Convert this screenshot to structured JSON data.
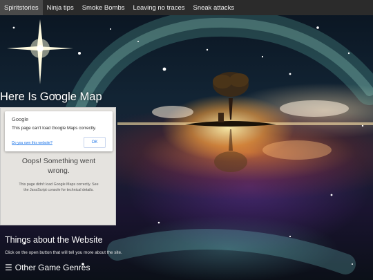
{
  "nav": {
    "items": [
      {
        "label": "Spiritstories",
        "active": true
      },
      {
        "label": "Ninja tips",
        "active": false
      },
      {
        "label": "Smoke Bombs",
        "active": false
      },
      {
        "label": "Leaving no traces",
        "active": false
      },
      {
        "label": "Sneak attacks",
        "active": false
      }
    ]
  },
  "main": {
    "title": "Here Is Google Map"
  },
  "map": {
    "brand": "Google",
    "error_message": "This page can't load Google Maps correctly.",
    "own_site_link": "Do you own this website?",
    "ok_label": "OK",
    "oops_title": "Oops! Something went wrong.",
    "oops_detail": "This page didn't load Google Maps correctly. See the JavaScript console for technical details."
  },
  "about": {
    "title": "Things about the Website",
    "description": "Click on the open button that will tell you more about the site."
  },
  "genres": {
    "icon": "hamburger-icon",
    "label": "Other Game Genres"
  },
  "colors": {
    "nav_bg": "#2b2b2b",
    "nav_active": "#4a4a4a",
    "map_bg": "#e5e3df",
    "link_blue": "#1a73e8"
  }
}
